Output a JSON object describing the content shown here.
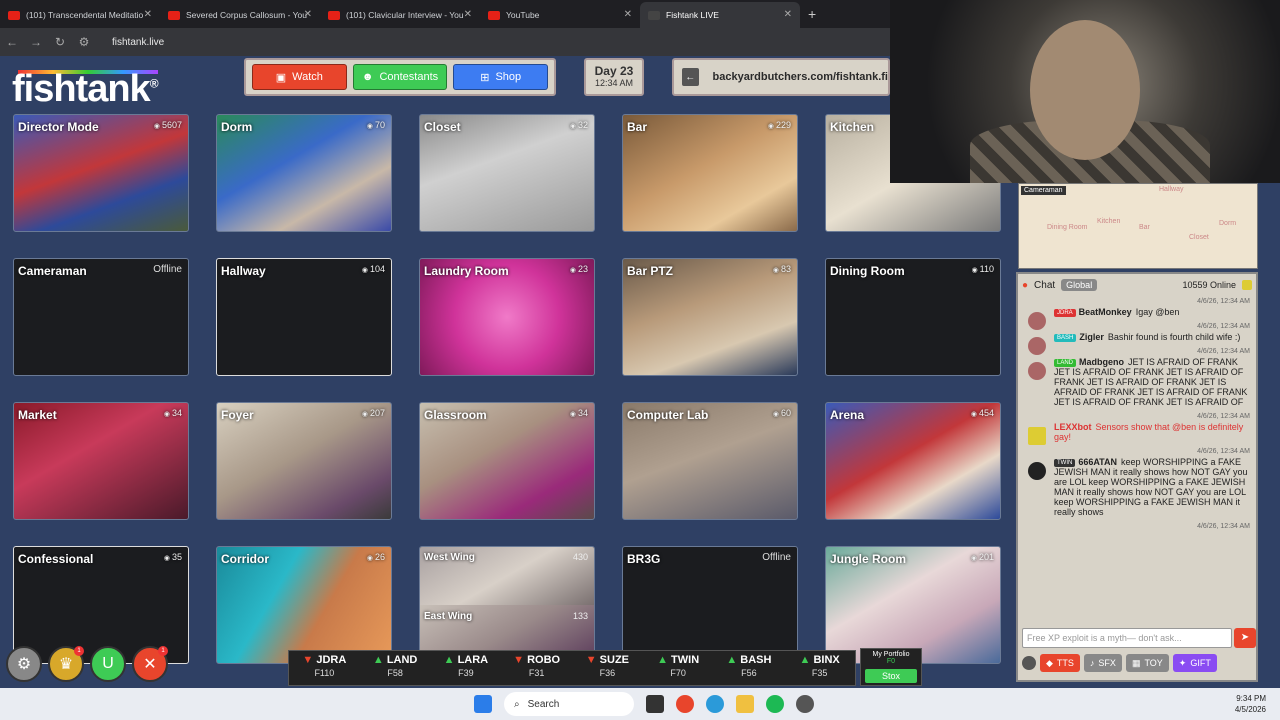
{
  "browser": {
    "tabs": [
      {
        "title": "(101) Transcendental Meditatio",
        "icon": "youtube-icon"
      },
      {
        "title": "Severed Corpus Callosum - You",
        "icon": "youtube-icon"
      },
      {
        "title": "(101) Clavicular Interview - You",
        "icon": "youtube-icon"
      },
      {
        "title": "YouTube",
        "icon": "youtube-icon"
      },
      {
        "title": "Fishtank LIVE",
        "icon": "fishtank-icon"
      }
    ],
    "url": "fishtank.live"
  },
  "logo": {
    "text": "fishtank",
    "reg": "®"
  },
  "nav": {
    "watch": "Watch",
    "contestants": "Contestants",
    "shop": "Shop"
  },
  "day": {
    "label": "Day 23",
    "time": "12:34 AM"
  },
  "ad": {
    "text": "backyardbutchers.com/fishtank.fi"
  },
  "cameras": [
    {
      "name": "Director Mode",
      "views": "5607"
    },
    {
      "name": "Dorm",
      "views": "70"
    },
    {
      "name": "Closet",
      "views": "32"
    },
    {
      "name": "Bar",
      "views": "229"
    },
    {
      "name": "Kitchen",
      "views": ""
    },
    {
      "name": "Cameraman",
      "status": "Offline"
    },
    {
      "name": "Hallway",
      "views": "104"
    },
    {
      "name": "Laundry Room",
      "views": "23"
    },
    {
      "name": "Bar PTZ",
      "views": "83"
    },
    {
      "name": "Dining Room",
      "views": "110"
    },
    {
      "name": "Market",
      "views": "34"
    },
    {
      "name": "Foyer",
      "views": "207"
    },
    {
      "name": "Glassroom",
      "views": "34"
    },
    {
      "name": "Computer Lab",
      "views": "60"
    },
    {
      "name": "Arena",
      "views": "454"
    },
    {
      "name": "Confessional",
      "views": "35"
    },
    {
      "name": "Corridor",
      "views": "26"
    },
    {
      "name": "West Wing",
      "views": "430",
      "name2": "East Wing",
      "views2": "133"
    },
    {
      "name": "BR3G",
      "status": "Offline"
    },
    {
      "name": "Jungle Room",
      "views": "201"
    }
  ],
  "map": {
    "tag": "Cameraman",
    "labels": [
      "Dining Room",
      "Kitchen",
      "Bar",
      "Hallway",
      "Closet",
      "Dorm"
    ]
  },
  "chat": {
    "title": "Chat",
    "tab": "Global",
    "online": "10559 Online",
    "messages": [
      {
        "ts": "4/6/26, 12:34 AM",
        "badge": "JDRA",
        "badge_color": "#d33",
        "user": "BeatMonkey",
        "user_color": "#222",
        "text": "Igay @ben"
      },
      {
        "ts": "4/6/26, 12:34 AM",
        "badge": "BASH",
        "badge_color": "#2bb",
        "user": "Zigler",
        "user_color": "#222",
        "text": "Bashir found is fourth child wife :)"
      },
      {
        "ts": "4/6/26, 12:34 AM",
        "badge": "LAND",
        "badge_color": "#3b3",
        "user": "Madbgeno",
        "user_color": "#222",
        "text": "JET IS AFRAID OF FRANK JET IS AFRAID OF FRANK JET IS AFRAID OF FRANK JET IS AFRAID OF FRANK JET IS AFRAID OF FRANK JET IS AFRAID OF FRANK JET IS AFRAID OF FRANK JET IS AFRAID OF"
      },
      {
        "ts": "4/6/26, 12:34 AM",
        "badge": "",
        "badge_color": "#fff",
        "user": "LEXXbot",
        "user_color": "#d33",
        "text": "Sensors show that @ben is definitely gay!"
      },
      {
        "ts": "4/6/26, 12:34 AM",
        "badge": "TWIN",
        "badge_color": "#333",
        "user": "666ATAN",
        "user_color": "#222",
        "text": "keep WORSHIPPING a FAKE JEWISH MAN it really shows how NOT GAY you are LOL keep WORSHIPPING a FAKE JEWISH MAN it really shows how NOT GAY you are LOL keep WORSHIPPING a FAKE JEWISH MAN it really shows"
      }
    ],
    "last_ts": "4/6/26, 12:34 AM",
    "placeholder": "Free XP exploit is a myth— don't ask...",
    "buttons": {
      "tts": "TTS",
      "sfx": "SFX",
      "toy": "TOY",
      "gift": "GIFT"
    }
  },
  "ticker": [
    {
      "name": "JDRA",
      "dir": "down",
      "price": "F110"
    },
    {
      "name": "LAND",
      "dir": "up",
      "price": "F58"
    },
    {
      "name": "LARA",
      "dir": "up",
      "price": "F39"
    },
    {
      "name": "ROBO",
      "dir": "down",
      "price": "F31"
    },
    {
      "name": "SUZE",
      "dir": "down",
      "price": "F36"
    },
    {
      "name": "TWIN",
      "dir": "up",
      "price": "F70"
    },
    {
      "name": "BASH",
      "dir": "up",
      "price": "F56"
    },
    {
      "name": "BINX",
      "dir": "up",
      "price": "F35"
    }
  ],
  "portfolio": {
    "label": "My Portfolio",
    "value": "F0",
    "button": "Stox"
  },
  "taskbar": {
    "search": "Search",
    "time": "9:34 PM",
    "date": "4/5/2026"
  }
}
